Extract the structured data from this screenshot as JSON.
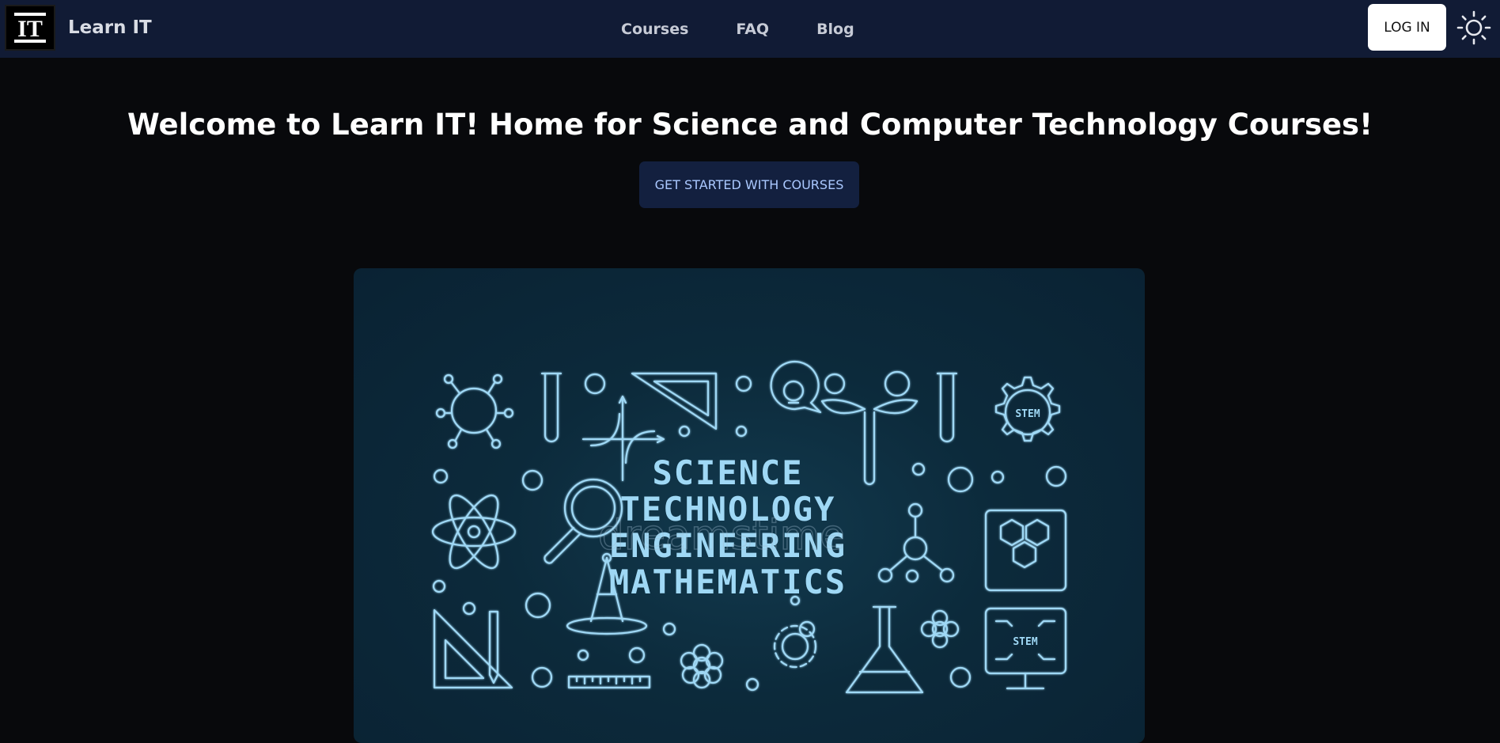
{
  "brand": {
    "logo_text": "IT",
    "name": "Learn IT",
    "logo_icon": "it-logo-icon"
  },
  "nav": {
    "links": [
      "Courses",
      "FAQ",
      "Blog"
    ]
  },
  "header": {
    "login_label": "LOG IN",
    "theme_icon": "sun-icon"
  },
  "hero": {
    "title": "Welcome to Learn IT! Home for Science and Computer Technology Courses!",
    "cta_label": "GET STARTED WITH COURSES"
  },
  "banner": {
    "lines": [
      "SCIENCE",
      "TECHNOLOGY",
      "ENGINEERING",
      "MATHEMATICS"
    ],
    "badge_top": "STEM",
    "badge_monitor": "STEM",
    "watermark": "dreamstime"
  },
  "colors": {
    "navbar_bg": "#111b35",
    "page_bg": "#08090c",
    "cta_bg": "#13203f",
    "cta_text": "#aac8ff",
    "icon_line": "#9fd8f5"
  }
}
